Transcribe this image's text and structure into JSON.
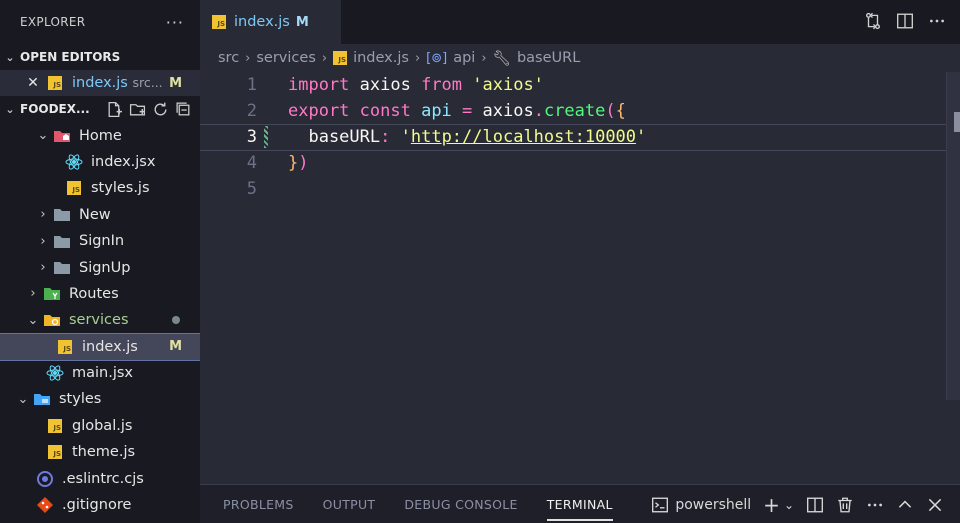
{
  "sidebar": {
    "title": "EXPLORER",
    "more": "···",
    "open_editors": {
      "label": "OPEN EDITORS",
      "items": [
        {
          "name": "index.js",
          "path": "src...",
          "badge": "M"
        }
      ]
    },
    "project": {
      "label": "FOODEX..."
    },
    "tree": [
      {
        "label": "Home",
        "kind": "folder-open",
        "depth": 2
      },
      {
        "label": "index.jsx",
        "kind": "react",
        "depth": 3
      },
      {
        "label": "styles.js",
        "kind": "js",
        "depth": 3
      },
      {
        "label": "New",
        "kind": "folder",
        "depth": 2
      },
      {
        "label": "SignIn",
        "kind": "folder",
        "depth": 2
      },
      {
        "label": "SignUp",
        "kind": "folder",
        "depth": 2
      },
      {
        "label": "Routes",
        "kind": "folder-routes",
        "depth": 1
      },
      {
        "label": "services",
        "kind": "folder-services",
        "depth": 1
      },
      {
        "label": "index.js",
        "kind": "js",
        "depth": 2,
        "badge": "M"
      },
      {
        "label": "main.jsx",
        "kind": "react",
        "depth": 1
      },
      {
        "label": "styles",
        "kind": "folder-styles",
        "depth": 0
      },
      {
        "label": "global.js",
        "kind": "js",
        "depth": 1
      },
      {
        "label": "theme.js",
        "kind": "js",
        "depth": 1
      },
      {
        "label": ".eslintrc.cjs",
        "kind": "eslint",
        "depth": 0
      },
      {
        "label": ".gitignore",
        "kind": "git",
        "depth": 0
      }
    ]
  },
  "tab": {
    "name": "index.js",
    "badge": "M"
  },
  "breadcrumb": {
    "src": "src",
    "services": "services",
    "file": "index.js",
    "var": "api",
    "prop": "baseURL"
  },
  "editor": {
    "lines": [
      {
        "n": "1"
      },
      {
        "n": "2"
      },
      {
        "n": "3"
      },
      {
        "n": "4"
      },
      {
        "n": "5"
      }
    ],
    "code": {
      "l1_import": "import",
      "l1_name": " axios ",
      "l1_from": "from",
      "l1_mod": " 'axios'",
      "l2_export": "export",
      "l2_const": " const ",
      "l2_api": "api",
      "l2_eq": " = ",
      "l2_axios": "axios",
      "l2_dot": ".",
      "l2_create": "create",
      "l2_paren": "(",
      "l2_brace": "{",
      "l3_key": "  baseURL",
      "l3_colon": ": ",
      "l3_q1": "'",
      "l3_url": "http://localhost:10000",
      "l3_q2": "'",
      "l4_brace": "}",
      "l4_paren": ")"
    }
  },
  "panel": {
    "tabs": [
      "PROBLEMS",
      "OUTPUT",
      "DEBUG CONSOLE",
      "TERMINAL"
    ],
    "terminal_name": "powershell"
  },
  "colors": {
    "accent": "#6272a4",
    "keyword": "#ff79c6",
    "string": "#f1fa8c",
    "function": "#50fa7b",
    "property": "#8be9fd"
  }
}
